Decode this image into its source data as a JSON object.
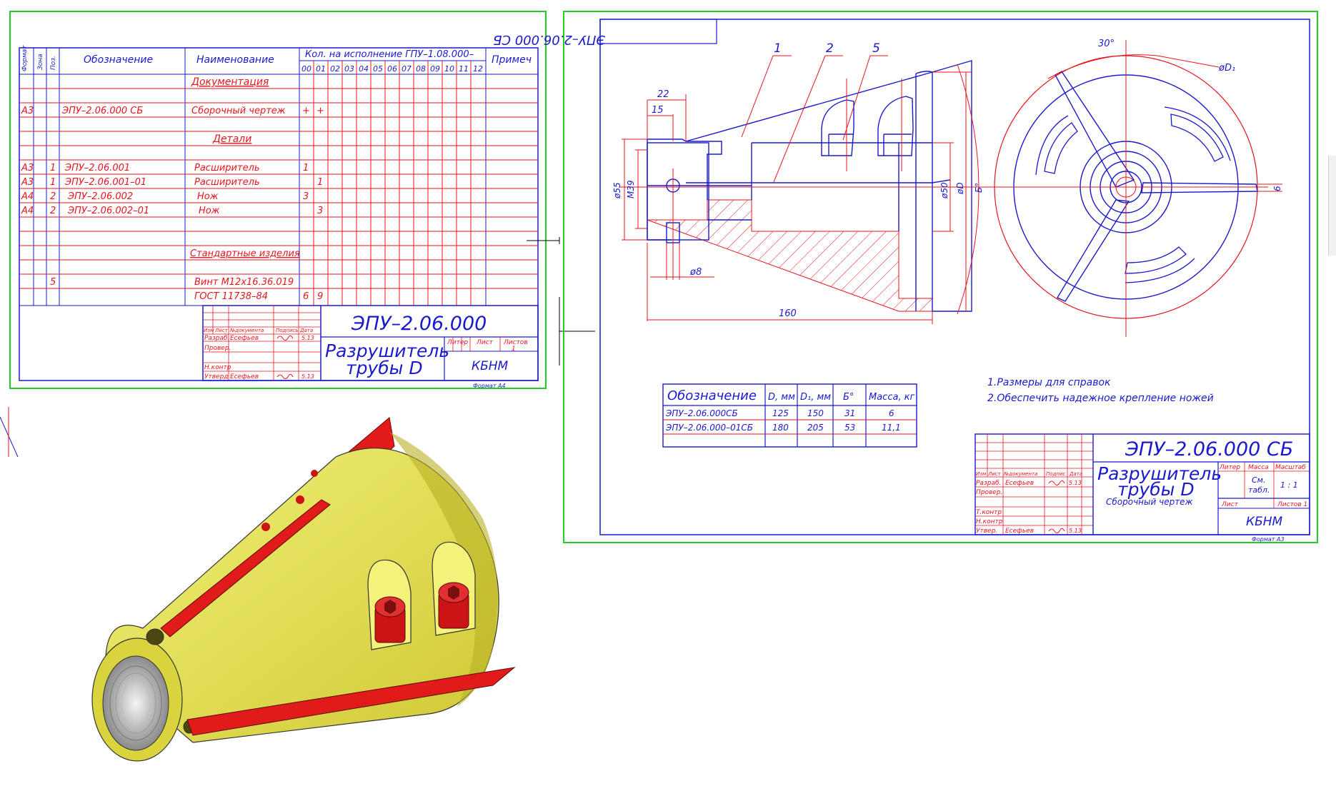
{
  "colors": {
    "frame_green": "#22cc22",
    "line_blue": "#1a1acc",
    "line_red": "#e8141e",
    "body_yellow": "#e6e34a",
    "knife_red": "#e11a1a"
  },
  "spec_sheet": {
    "headers": {
      "format": "Формат",
      "zone": "Зона",
      "pos": "Поз.",
      "designation": "Обозначение",
      "name": "Наименование",
      "qty_variant": "Кол. на исполнение ГПУ–1.08.000–",
      "note": "Примеч",
      "variants": [
        "00",
        "01",
        "02",
        "03",
        "04",
        "05",
        "06",
        "07",
        "08",
        "09",
        "10",
        "11",
        "12"
      ]
    },
    "sections": {
      "documentation": "Документация",
      "details": "Детали",
      "standard": "Стандартные изделия"
    },
    "rows": [
      {
        "format": "А3",
        "zone": "",
        "pos": "",
        "designation": "ЭПУ–2.06.000 СБ",
        "name": "Сборочный чертеж",
        "q00": "+",
        "q01": "+"
      },
      {
        "format": "А3",
        "zone": "",
        "pos": "1",
        "designation": "ЭПУ–2.06.001",
        "name": "Расширитель",
        "q00": "1",
        "q01": ""
      },
      {
        "format": "А3",
        "zone": "",
        "pos": "1",
        "designation": "ЭПУ–2.06.001–01",
        "name": "Расширитель",
        "q00": "",
        "q01": "1"
      },
      {
        "format": "А4",
        "zone": "",
        "pos": "2",
        "designation": "ЭПУ–2.06.002",
        "name": "Нож",
        "q00": "3",
        "q01": ""
      },
      {
        "format": "А4",
        "zone": "",
        "pos": "2",
        "designation": "ЭПУ–2.06.002–01",
        "name": "Нож",
        "q00": "",
        "q01": "3"
      },
      {
        "format": "",
        "zone": "",
        "pos": "5",
        "designation": "",
        "name": "Винт М12х16.36.019",
        "q00": "",
        "q01": ""
      },
      {
        "format": "",
        "zone": "",
        "pos": "",
        "designation": "",
        "name": "ГОСТ 11738–84",
        "q00": "6",
        "q01": "9"
      }
    ],
    "title_block": {
      "code": "ЭПУ–2.06.000",
      "name_line1": "Разрушитель",
      "name_line2": "трубы D",
      "org": "КБНМ",
      "col_izm": "Изм",
      "col_list": "Лист",
      "col_doc": "№документа",
      "col_sign": "Подпись",
      "col_date": "Дата",
      "razrab": "Разраб.",
      "prover": "Провер.",
      "nkontr": "Н.контр",
      "utverd": "Утверд",
      "author": "Есефьев",
      "date": "5.13",
      "liter": "Литер",
      "list": "Лист",
      "listov": "Листов",
      "listov_val": "1",
      "format": "Формат А4"
    }
  },
  "assembly": {
    "stamp": "ЭПУ–2.06.000 СБ",
    "leaders": [
      "1",
      "2",
      "5"
    ],
    "dims": {
      "d22": "22",
      "d15": "15",
      "d55": "ø55",
      "m39": "M39",
      "d8": "ø8",
      "d160": "160",
      "d50": "ø50",
      "dD": "øD",
      "b": "Б°",
      "angle": "30°",
      "dD1": "øD₁",
      "d6": "6"
    },
    "notes": [
      "1.Размеры для справок",
      "2.Обеспечить надежное крепление ножей"
    ],
    "variant_table": {
      "headers": [
        "Обозначение",
        "D, мм",
        "D₁, мм",
        "Б°",
        "Масса, кг"
      ],
      "rows": [
        [
          "ЭПУ–2.06.000СБ",
          "125",
          "150",
          "31",
          "6"
        ],
        [
          "ЭПУ–2.06.000–01СБ",
          "180",
          "205",
          "53",
          "11,1"
        ]
      ]
    },
    "title_block": {
      "code": "ЭПУ–2.06.000 СБ",
      "name_line1": "Разрушитель",
      "name_line2": "трубы D",
      "subtitle": "Сборочный чертеж",
      "liter": "Литер",
      "mass": "Масса",
      "scale": "Масштаб",
      "mass_val1": "См.",
      "mass_val2": "табл.",
      "scale_val": "1 : 1",
      "sheet": "Лист",
      "sheets": "Листов 1",
      "org": "КБНМ",
      "tkontr": "Т.контр",
      "nkontr": "Н.контр",
      "utverd": "Утвер.",
      "razrab": "Разраб.",
      "prover": "Провер.",
      "author": "Есефьев",
      "date": "5.13",
      "col_izm": "Изм",
      "col_list": "Лист",
      "col_doc": "№документа",
      "col_sign": "Подпис",
      "col_date": "Дата",
      "format": "Формат А3"
    }
  }
}
